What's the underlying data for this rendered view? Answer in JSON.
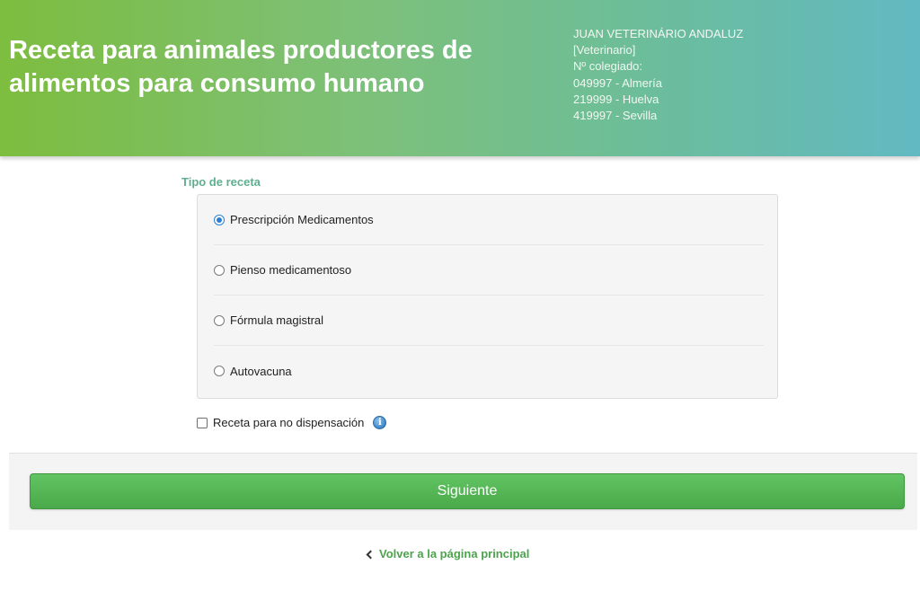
{
  "header": {
    "title": "Receta para animales productores de alimentos para consumo humano",
    "vet_name": "JUAN VETERINÁRIO ANDALUZ",
    "vet_role": "[Veterinario]",
    "colegiado_label": "Nº colegiado:",
    "colegiados": [
      "049997 - Almería",
      "219999 - Huelva",
      "419997 - Sevilla"
    ]
  },
  "form": {
    "section_label": "Tipo de receta",
    "options": [
      {
        "label": "Prescripción Medicamentos",
        "checked": true
      },
      {
        "label": "Pienso medicamentoso",
        "checked": false
      },
      {
        "label": "Fórmula magistral",
        "checked": false
      },
      {
        "label": "Autovacuna",
        "checked": false
      }
    ],
    "no_dispensacion_label": "Receta para no dispensación",
    "no_dispensacion_checked": false,
    "info_icon": "info-icon"
  },
  "actions": {
    "next_label": "Siguiente",
    "back_label": "Volver a la página principal"
  }
}
